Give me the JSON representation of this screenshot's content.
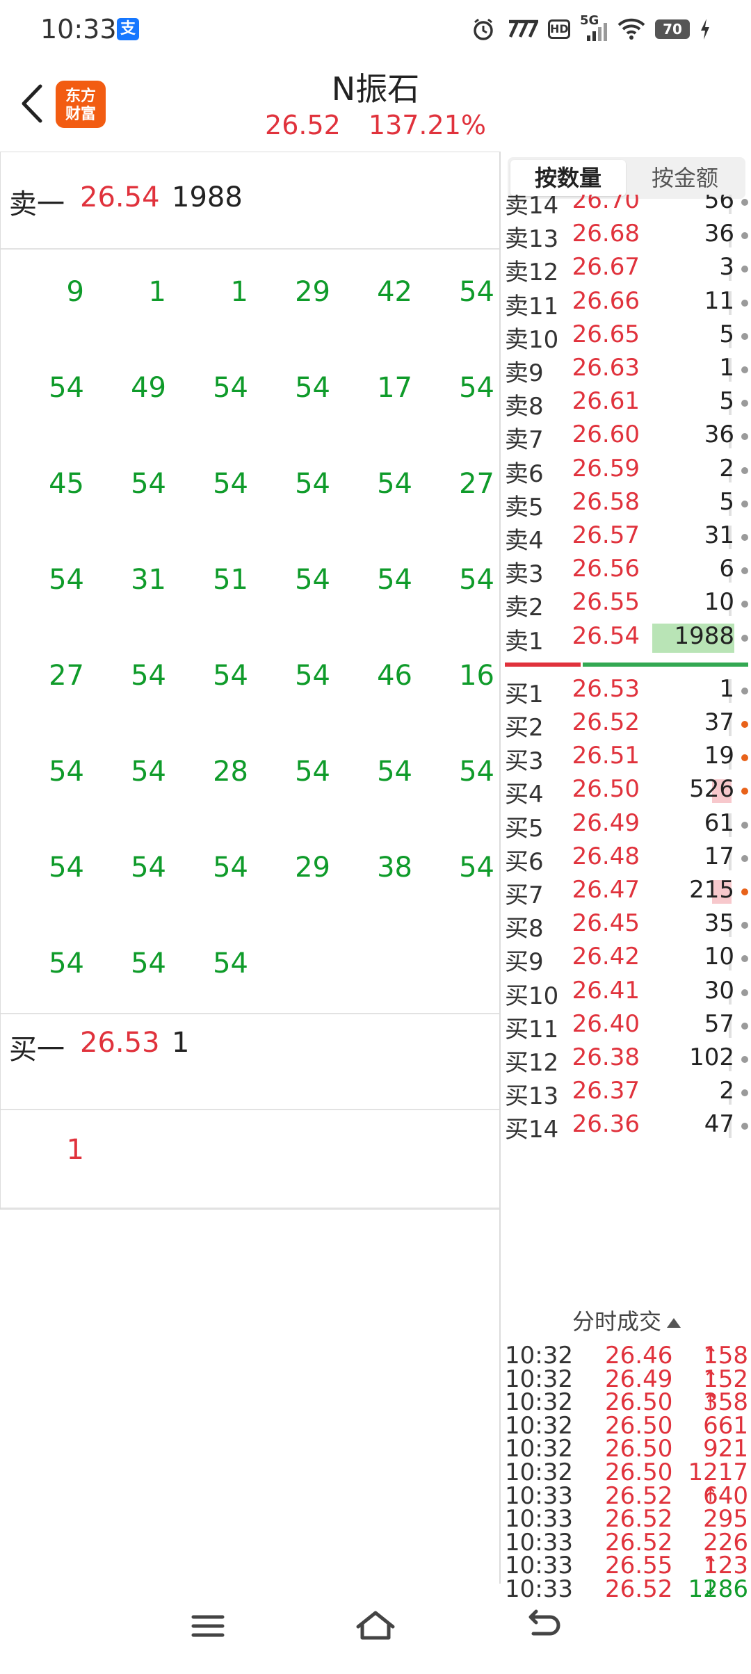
{
  "status_bar": {
    "time": "10:33",
    "alipay_icon_label": "支",
    "network_label": "5G",
    "hd_label": "HD",
    "battery": "70"
  },
  "header": {
    "stock_name": "N振石",
    "price": "26.52",
    "change_pct": "137.21%",
    "logo_line1": "东方",
    "logo_line2": "财富"
  },
  "level2": {
    "ask1": {
      "label": "卖一",
      "price": "26.54",
      "volume": "1988"
    },
    "ask1_queue": [
      "9",
      "1",
      "1",
      "29",
      "42",
      "54",
      "54",
      "49",
      "54",
      "54",
      "17",
      "54",
      "45",
      "54",
      "54",
      "54",
      "54",
      "27",
      "54",
      "31",
      "51",
      "54",
      "54",
      "54",
      "27",
      "54",
      "54",
      "54",
      "46",
      "16",
      "54",
      "54",
      "28",
      "54",
      "54",
      "54",
      "54",
      "54",
      "54",
      "29",
      "38",
      "54",
      "54",
      "54",
      "54"
    ],
    "bid1": {
      "label": "买一",
      "price": "26.53",
      "volume": "1"
    },
    "bid1_queue": [
      "1"
    ]
  },
  "toggle": {
    "by_volume": "按数量",
    "by_amount": "按金额"
  },
  "order_book": {
    "asks": [
      {
        "label": "卖14",
        "price": "26.70",
        "volume": "56",
        "dot": "gray"
      },
      {
        "label": "卖13",
        "price": "26.68",
        "volume": "36",
        "dot": "gray"
      },
      {
        "label": "卖12",
        "price": "26.67",
        "volume": "3",
        "dot": "gray"
      },
      {
        "label": "卖11",
        "price": "26.66",
        "volume": "11",
        "dot": "gray"
      },
      {
        "label": "卖10",
        "price": "26.65",
        "volume": "5",
        "dot": "gray"
      },
      {
        "label": "卖9",
        "price": "26.63",
        "volume": "1",
        "dot": "gray"
      },
      {
        "label": "卖8",
        "price": "26.61",
        "volume": "5",
        "dot": "gray"
      },
      {
        "label": "卖7",
        "price": "26.60",
        "volume": "36",
        "dot": "gray"
      },
      {
        "label": "卖6",
        "price": "26.59",
        "volume": "2",
        "dot": "gray"
      },
      {
        "label": "卖5",
        "price": "26.58",
        "volume": "5",
        "dot": "gray"
      },
      {
        "label": "卖4",
        "price": "26.57",
        "volume": "31",
        "dot": "gray"
      },
      {
        "label": "卖3",
        "price": "26.56",
        "volume": "6",
        "dot": "gray"
      },
      {
        "label": "卖2",
        "price": "26.55",
        "volume": "10",
        "dot": "gray"
      },
      {
        "label": "卖1",
        "price": "26.54",
        "volume": "1988",
        "dot": "gray",
        "highlight": true
      }
    ],
    "bids": [
      {
        "label": "买1",
        "price": "26.53",
        "volume": "1",
        "dot": "gray"
      },
      {
        "label": "买2",
        "price": "26.52",
        "volume": "37",
        "dot": "orange"
      },
      {
        "label": "买3",
        "price": "26.51",
        "volume": "19",
        "dot": "orange"
      },
      {
        "label": "买4",
        "price": "26.50",
        "volume": "526",
        "dot": "orange",
        "pink": true
      },
      {
        "label": "买5",
        "price": "26.49",
        "volume": "61",
        "dot": "gray"
      },
      {
        "label": "买6",
        "price": "26.48",
        "volume": "17",
        "dot": "gray"
      },
      {
        "label": "买7",
        "price": "26.47",
        "volume": "215",
        "dot": "orange",
        "pink": true
      },
      {
        "label": "买8",
        "price": "26.45",
        "volume": "35",
        "dot": "gray"
      },
      {
        "label": "买9",
        "price": "26.42",
        "volume": "10",
        "dot": "gray"
      },
      {
        "label": "买10",
        "price": "26.41",
        "volume": "30",
        "dot": "gray"
      },
      {
        "label": "买11",
        "price": "26.40",
        "volume": "57",
        "dot": "gray"
      },
      {
        "label": "买12",
        "price": "26.38",
        "volume": "102",
        "dot": "gray"
      },
      {
        "label": "买13",
        "price": "26.37",
        "volume": "2",
        "dot": "gray"
      },
      {
        "label": "买14",
        "price": "26.36",
        "volume": "47",
        "dot": "gray"
      }
    ],
    "split_ratio": 0.31,
    "colors": {
      "up": "#e0323c",
      "down": "#0f9b2a",
      "ask_bar": "#b9e4b6"
    }
  },
  "time_sales": {
    "title": "分时成交",
    "rows": [
      {
        "time": "10:32",
        "price": "26.46",
        "arrow": "↑",
        "volume": "158",
        "side": "buy"
      },
      {
        "time": "10:32",
        "price": "26.49",
        "arrow": "↑",
        "volume": "152",
        "side": "buy"
      },
      {
        "time": "10:32",
        "price": "26.50",
        "arrow": "↑",
        "volume": "358",
        "side": "buy"
      },
      {
        "time": "10:32",
        "price": "26.50",
        "arrow": "",
        "volume": "661",
        "side": "buy"
      },
      {
        "time": "10:32",
        "price": "26.50",
        "arrow": "",
        "volume": "921",
        "side": "buy"
      },
      {
        "time": "10:32",
        "price": "26.50",
        "arrow": "",
        "volume": "1217",
        "side": "buy"
      },
      {
        "time": "10:33",
        "price": "26.52",
        "arrow": "↑",
        "volume": "640",
        "side": "buy"
      },
      {
        "time": "10:33",
        "price": "26.52",
        "arrow": "",
        "volume": "295",
        "side": "buy"
      },
      {
        "time": "10:33",
        "price": "26.52",
        "arrow": "",
        "volume": "226",
        "side": "buy"
      },
      {
        "time": "10:33",
        "price": "26.55",
        "arrow": "↑",
        "volume": "123",
        "side": "buy"
      },
      {
        "time": "10:33",
        "price": "26.52",
        "arrow": "↓",
        "volume": "1286",
        "side": "sell"
      }
    ]
  },
  "nav": {
    "menu_icon": "menu-icon",
    "home_icon": "home-icon",
    "back_icon": "back-icon"
  }
}
